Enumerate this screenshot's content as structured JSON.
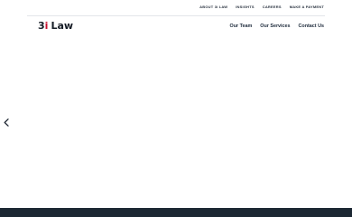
{
  "utility_nav": {
    "items": [
      "ABOUT 3i LAW",
      "INSIGHTS",
      "CAREERS",
      "MAKE A PAYMENT"
    ]
  },
  "brand": {
    "num": "3",
    "i": "i",
    "word": "Law",
    "accent_color": "#c8102e"
  },
  "main_nav": {
    "items": [
      "Our Team",
      "Our Services",
      "Contact Us"
    ]
  },
  "hero": {
    "prev_icon": "chevron-left-icon"
  },
  "colors": {
    "footer": "#1c2833",
    "text_dark": "#1d2a3b"
  }
}
